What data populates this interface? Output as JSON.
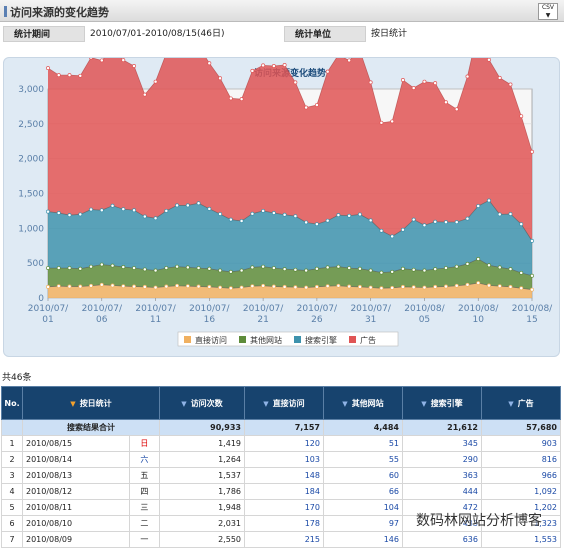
{
  "header": {
    "title": "访问来源的变化趋势",
    "csv_label": "CSV"
  },
  "meta": {
    "period_label": "统计期间",
    "period_value": "2010/07/01-2010/08/15(46日)",
    "unit_label": "统计单位",
    "unit_value": "按日统计"
  },
  "chart_data": {
    "type": "area",
    "title": "访问来源变化趋势",
    "stacked": true,
    "ylim": [
      0,
      3000
    ],
    "yticks": [
      "0",
      "500",
      "1,000",
      "1,500",
      "2,000",
      "2,500",
      "3,000"
    ],
    "xticks": [
      {
        "i": 0,
        "l1": "2010/07/",
        "l2": "01"
      },
      {
        "i": 5,
        "l1": "2010/07/",
        "l2": "06"
      },
      {
        "i": 10,
        "l1": "2010/07/",
        "l2": "11"
      },
      {
        "i": 15,
        "l1": "2010/07/",
        "l2": "16"
      },
      {
        "i": 20,
        "l1": "2010/07/",
        "l2": "21"
      },
      {
        "i": 25,
        "l1": "2010/07/",
        "l2": "26"
      },
      {
        "i": 30,
        "l1": "2010/07/",
        "l2": "31"
      },
      {
        "i": 35,
        "l1": "2010/08/",
        "l2": "05"
      },
      {
        "i": 40,
        "l1": "2010/08/",
        "l2": "10"
      },
      {
        "i": 45,
        "l1": "2010/08/",
        "l2": "15"
      }
    ],
    "series": [
      {
        "name": "直接访问",
        "color": "#f0b060",
        "values": [
          160,
          170,
          165,
          165,
          175,
          190,
          180,
          170,
          165,
          160,
          150,
          165,
          175,
          170,
          165,
          160,
          150,
          140,
          150,
          170,
          175,
          165,
          160,
          155,
          150,
          160,
          170,
          175,
          165,
          160,
          150,
          140,
          145,
          160,
          155,
          150,
          160,
          165,
          175,
          190,
          215,
          180,
          170,
          160,
          140,
          120
        ]
      },
      {
        "name": "其他网站",
        "color": "#5e8c3a",
        "values": [
          270,
          260,
          265,
          255,
          275,
          290,
          285,
          275,
          265,
          250,
          245,
          265,
          275,
          270,
          265,
          260,
          245,
          235,
          245,
          270,
          275,
          265,
          255,
          250,
          245,
          260,
          270,
          275,
          265,
          260,
          245,
          225,
          230,
          260,
          250,
          245,
          255,
          265,
          275,
          300,
          345,
          290,
          270,
          255,
          220,
          200
        ]
      },
      {
        "name": "搜索引擎",
        "color": "#3d92ad",
        "values": [
          810,
          790,
          760,
          780,
          820,
          780,
          860,
          830,
          830,
          760,
          750,
          820,
          880,
          890,
          930,
          860,
          810,
          750,
          710,
          770,
          800,
          790,
          780,
          770,
          690,
          640,
          670,
          740,
          750,
          780,
          720,
          600,
          510,
          560,
          720,
          650,
          680,
          660,
          640,
          650,
          760,
          930,
          760,
          790,
          700,
          500
        ]
      },
      {
        "name": "广告",
        "color": "#e05555",
        "values": [
          2060,
          1980,
          2010,
          1990,
          2180,
          2150,
          2240,
          2140,
          2070,
          1750,
          1960,
          2260,
          2350,
          2300,
          2260,
          2090,
          1950,
          1740,
          1750,
          2050,
          2090,
          2110,
          2150,
          1920,
          1650,
          1710,
          2140,
          2300,
          2230,
          2350,
          1980,
          1550,
          1650,
          2150,
          1890,
          2060,
          1990,
          1720,
          1620,
          2040,
          2540,
          2020,
          1960,
          1860,
          1550,
          1280
        ]
      }
    ],
    "legend": [
      "直接访问",
      "其他网站",
      "搜索引擎",
      "广告"
    ]
  },
  "count_label": "共46条",
  "table": {
    "headers": {
      "no": "No.",
      "day": "按日统计",
      "visits": "访问次数",
      "direct": "直接访问",
      "other": "其他网站",
      "search": "搜索引擎",
      "ad": "广告"
    },
    "summary": {
      "label": "搜索结果合计",
      "visits": "90,933",
      "direct": "7,157",
      "other": "4,484",
      "search": "21,612",
      "ad": "57,680"
    },
    "rows": [
      {
        "no": "1",
        "date": "2010/08/15",
        "wd": "日",
        "visits": "1,419",
        "direct": "120",
        "other": "51",
        "search": "345",
        "ad": "903"
      },
      {
        "no": "2",
        "date": "2010/08/14",
        "wd": "六",
        "visits": "1,264",
        "direct": "103",
        "other": "55",
        "search": "290",
        "ad": "816"
      },
      {
        "no": "3",
        "date": "2010/08/13",
        "wd": "五",
        "visits": "1,537",
        "direct": "148",
        "other": "60",
        "search": "363",
        "ad": "966"
      },
      {
        "no": "4",
        "date": "2010/08/12",
        "wd": "四",
        "visits": "1,786",
        "direct": "184",
        "other": "66",
        "search": "444",
        "ad": "1,092"
      },
      {
        "no": "5",
        "date": "2010/08/11",
        "wd": "三",
        "visits": "1,948",
        "direct": "170",
        "other": "104",
        "search": "472",
        "ad": "1,202"
      },
      {
        "no": "6",
        "date": "2010/08/10",
        "wd": "二",
        "visits": "2,031",
        "direct": "178",
        "other": "97",
        "search": "433",
        "ad": "1,323"
      },
      {
        "no": "7",
        "date": "2010/08/09",
        "wd": "一",
        "visits": "2,550",
        "direct": "215",
        "other": "146",
        "search": "636",
        "ad": "1,553"
      }
    ]
  },
  "watermark": "数码林网站分析博客"
}
